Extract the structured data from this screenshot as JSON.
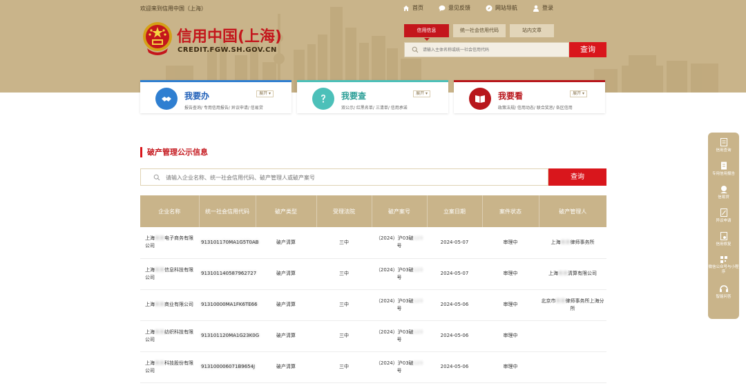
{
  "topbar": {
    "welcome": "欢迎来到信用中国（上海）",
    "nav": [
      {
        "icon": "home-icon",
        "label": "首页"
      },
      {
        "icon": "feedback-icon",
        "label": "意见反馈"
      },
      {
        "icon": "compass-icon",
        "label": "网站导航"
      },
      {
        "icon": "user-icon",
        "label": "登录"
      }
    ]
  },
  "logo": {
    "title": "信用中国(上海)",
    "domain": "CREDIT.FGW.SH.GOV.CN"
  },
  "search": {
    "tabs": [
      "信用信息",
      "统一社会信用代码",
      "站内文章"
    ],
    "placeholder": "请输入主体名称或统一社会信用代码",
    "button": "查询"
  },
  "cards": [
    {
      "title": "我要办",
      "desc": "报告查询/ 专用信用报告/ 异议申请/ 信易贷",
      "expand": "展开 ▾",
      "color": "#2f7fd1",
      "icon": "handshake-icon"
    },
    {
      "title": "我要查",
      "desc": "双公示/ 红黑名单/ 三清单/ 信用承诺",
      "expand": "展开 ▾",
      "color": "#4cc0b9",
      "icon": "question-icon"
    },
    {
      "title": "我要看",
      "desc": "政策法规/ 信用动态/ 联合奖惩/ 各区信用",
      "expand": "展开 ▾",
      "color": "#b8161c",
      "icon": "book-icon"
    }
  ],
  "section": {
    "title": "破产管理公示信息",
    "search_placeholder": "请输入企业名称、统一社会信用代码、破产管理人或破产案号",
    "search_button": "查询"
  },
  "table": {
    "headers": [
      "企业名称",
      "统一社会信用代码",
      "破产类型",
      "受理法院",
      "破产案号",
      "立案日期",
      "案件状态",
      "破产管理人"
    ],
    "rows": [
      {
        "name_a": "上海",
        "name_b": "电子商务有限公司",
        "code": "913101170MA1G5T0AB",
        "type": "破产清算",
        "court": "三中",
        "case_a": "（2024）沪03破",
        "case_b": "号",
        "date": "2024-05-07",
        "status": "审理中",
        "admin_a": "上海",
        "admin_b": "律师事务所"
      },
      {
        "name_a": "上海",
        "name_b": "信息科技有限公司",
        "code": "913101140587962727",
        "type": "破产清算",
        "court": "三中",
        "case_a": "（2024）沪03破",
        "case_b": "号",
        "date": "2024-05-07",
        "status": "审理中",
        "admin_a": "上海",
        "admin_b": "清算有限公司"
      },
      {
        "name_a": "上海",
        "name_b": "商业有限公司",
        "code": "91310000MA1FK6TE66",
        "type": "破产清算",
        "court": "三中",
        "case_a": "（2024）沪03破",
        "case_b": "号",
        "date": "2024-05-06",
        "status": "审理中",
        "admin_a": "北京市",
        "admin_b": "律师事务所上海分所"
      },
      {
        "name_a": "上海",
        "name_b": "纺织科技有限公司",
        "code": "913101120MA1G23K0G",
        "type": "破产清算",
        "court": "三中",
        "case_a": "（2024）沪03破",
        "case_b": "号",
        "date": "2024-05-06",
        "status": "审理中",
        "admin_a": "",
        "admin_b": ""
      },
      {
        "name_a": "上海",
        "name_b": "科技股份有限公司",
        "code": "913100006071B9654J",
        "type": "破产清算",
        "court": "三中",
        "case_a": "（2024）沪03破",
        "case_b": "号",
        "date": "2024-05-06",
        "status": "审理中",
        "admin_a": "",
        "admin_b": ""
      }
    ]
  },
  "float_panel": [
    {
      "icon": "credit-query-icon",
      "label": "信用查询"
    },
    {
      "icon": "credit-report-icon",
      "label": "专用信用报告"
    },
    {
      "icon": "loan-icon",
      "label": "信易贷"
    },
    {
      "icon": "objection-icon",
      "label": "异议申请"
    },
    {
      "icon": "repair-icon",
      "label": "信用修复"
    },
    {
      "icon": "qrcode-icon",
      "label": "微信公众号与小程序"
    },
    {
      "icon": "robot-icon",
      "label": "智能问答"
    }
  ],
  "colors": {
    "brand_red": "#d9161c",
    "gold": "#c9b48a"
  }
}
